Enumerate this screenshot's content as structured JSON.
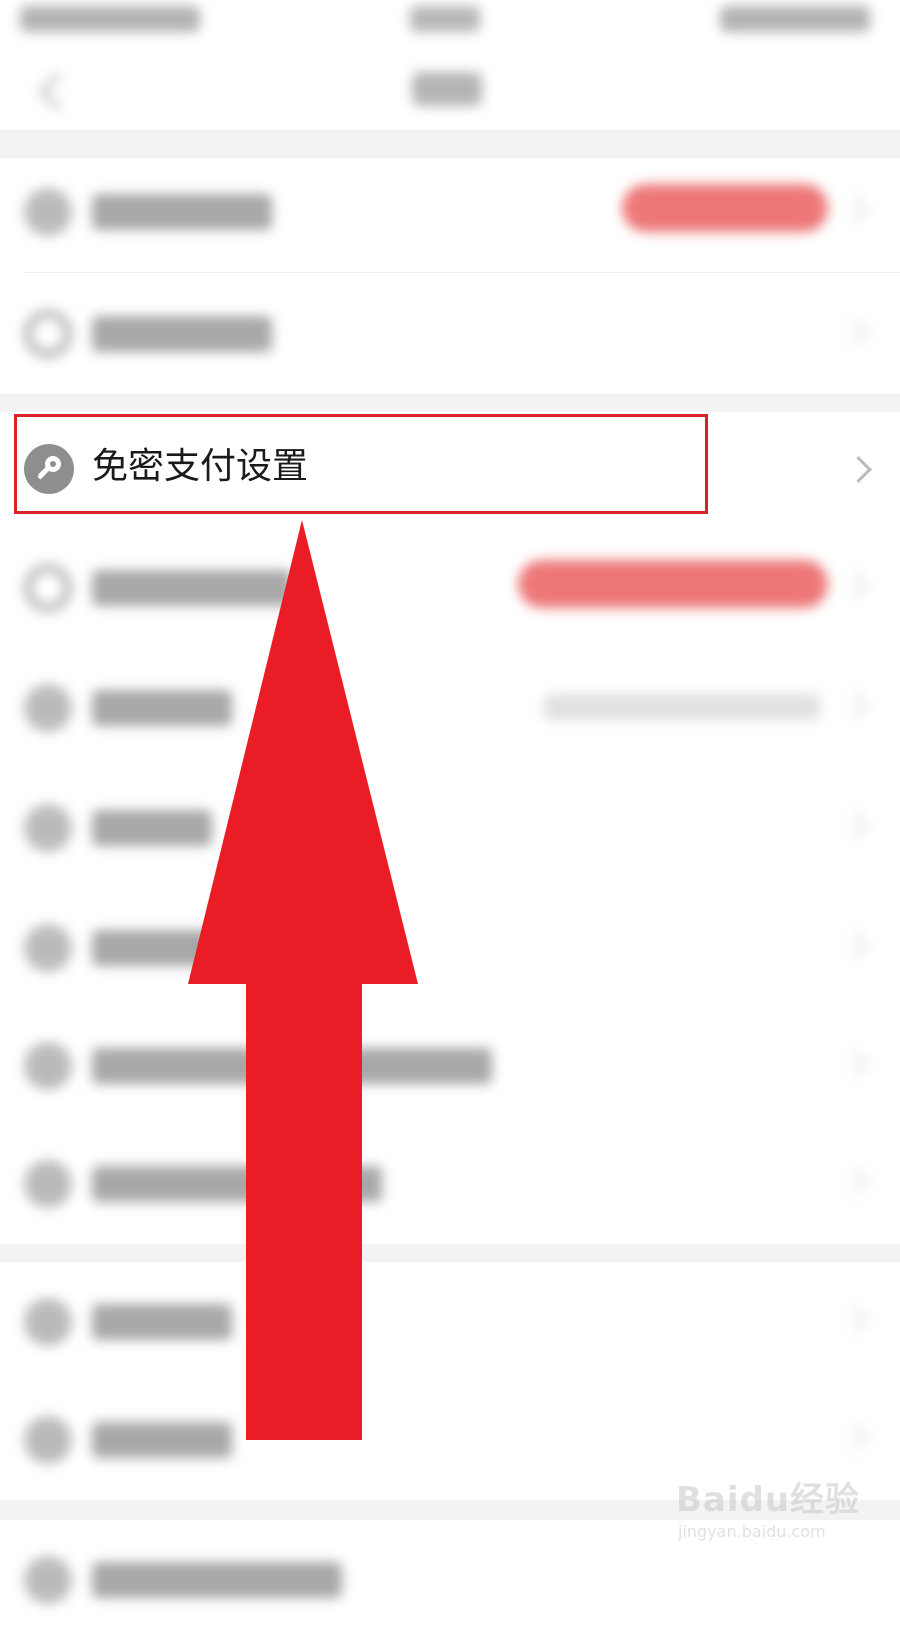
{
  "focus_item": {
    "label": "免密支付设置",
    "icon": "key-icon"
  },
  "watermark": {
    "brand": "Baidu经验",
    "url": "jingyan.baidu.com"
  },
  "colors": {
    "highlight_border": "#d8232a",
    "arrow_fill": "#ea1d27",
    "badge_red": "#e84a4a"
  }
}
